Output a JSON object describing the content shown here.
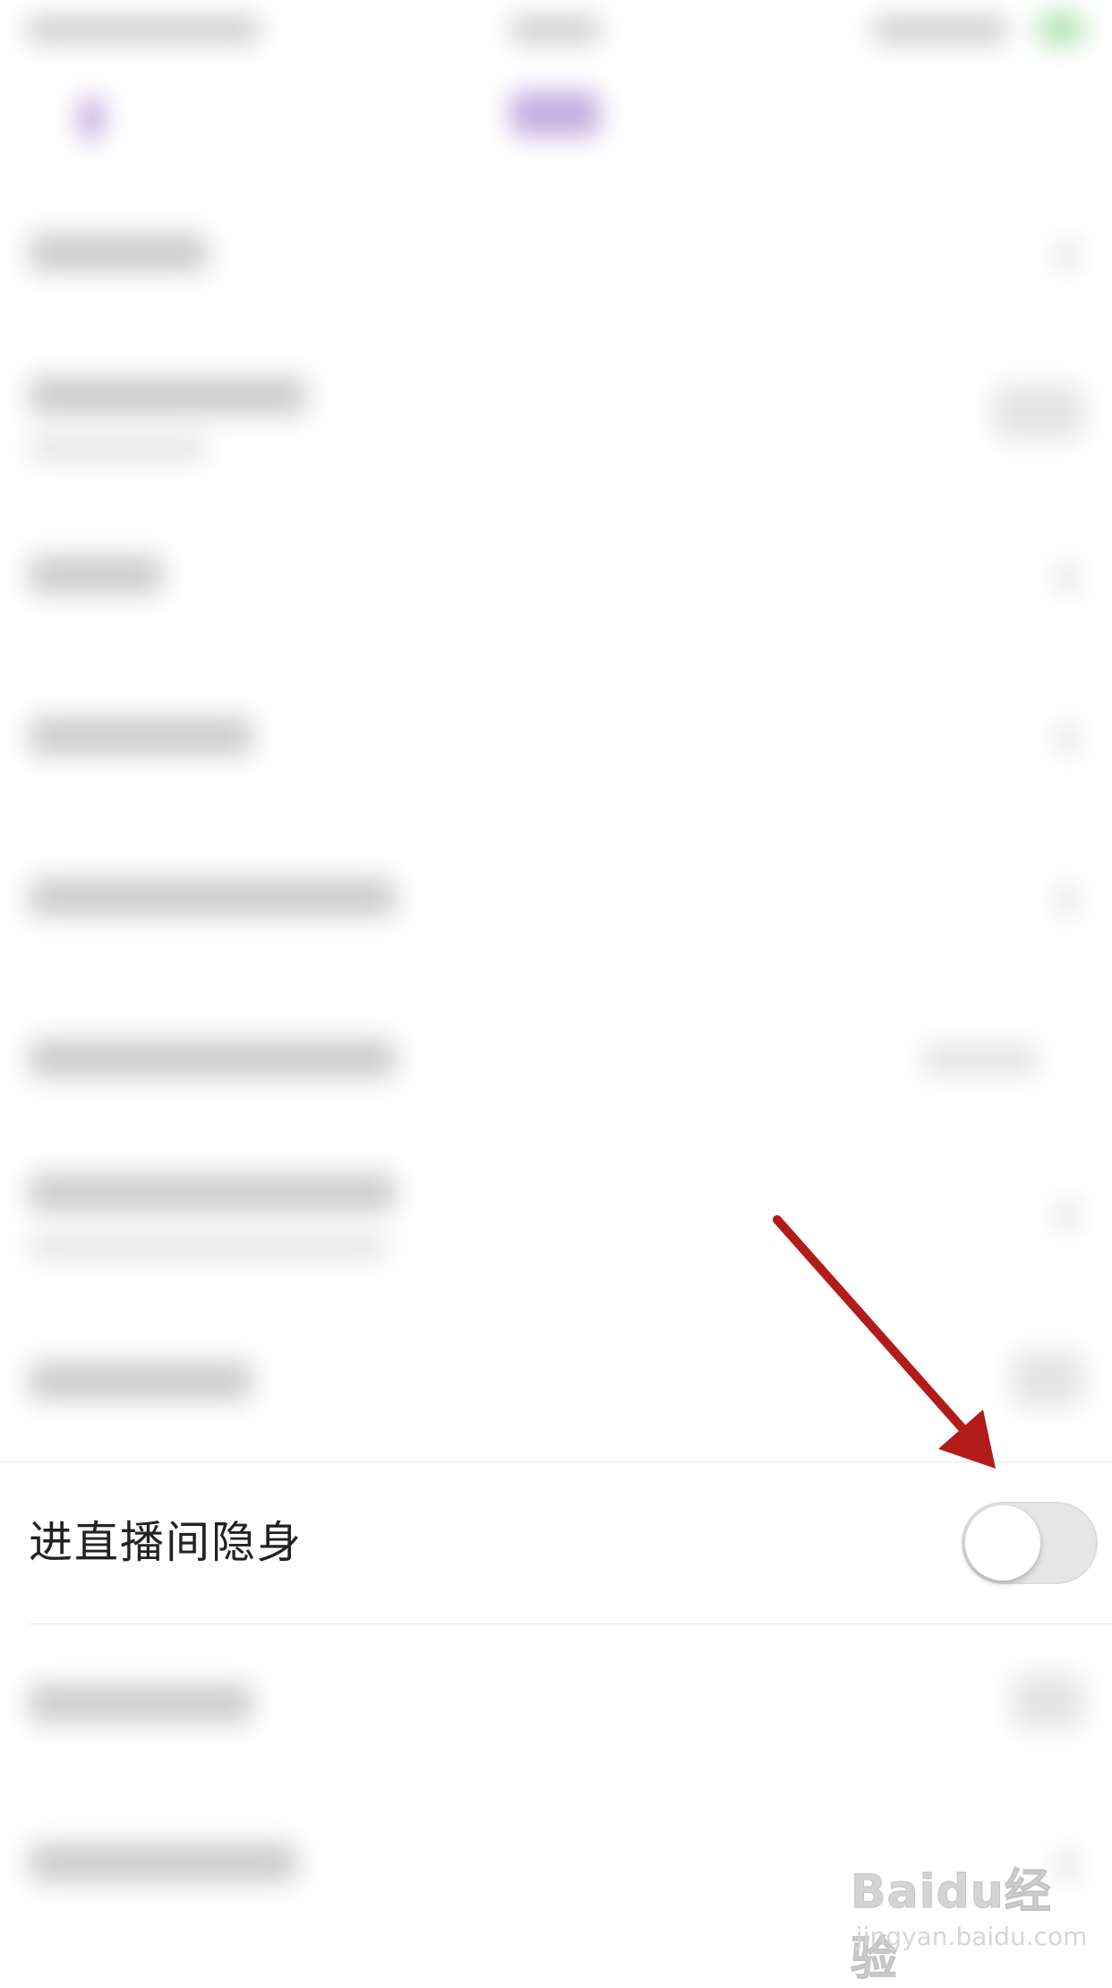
{
  "settings": {
    "highlighted_row": {
      "label": "进直播间隐身",
      "toggle_on": false
    }
  },
  "watermark": {
    "brand": "Baidu经验",
    "site": "jingyan.baidu.com"
  },
  "colors": {
    "annotation_arrow": "#b31b1b",
    "toggle_track_off": "#e6e6e6",
    "accent_purple": "#9a78c9"
  }
}
